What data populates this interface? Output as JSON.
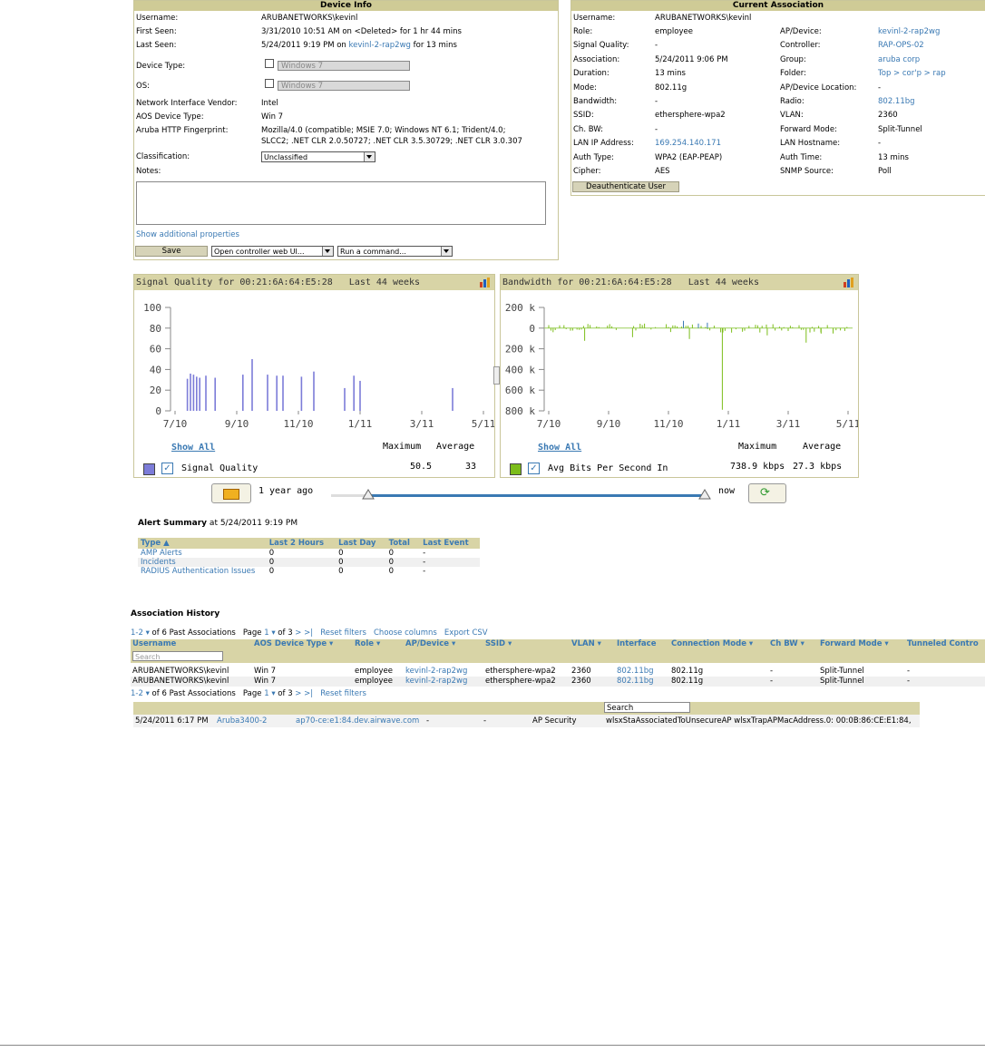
{
  "device_info": {
    "title": "Device Info",
    "rows": [
      {
        "label": "Username:",
        "value": "ARUBANETWORKS\\kevinl"
      },
      {
        "label": "First Seen:",
        "value": "3/31/2010 10:51 AM on <Deleted> for 1 hr 44 mins"
      },
      {
        "label": "Last Seen:",
        "value_pre": "5/24/2011 9:19 PM on ",
        "value_link": "kevinl-2-rap2wg",
        "value_post": " for 13 mins"
      }
    ],
    "device_type_label": "Device Type:",
    "device_type_value": "Windows 7",
    "os_label": "OS:",
    "os_value": "Windows 7",
    "vendor_label": "Network Interface Vendor:",
    "vendor_value": "Intel",
    "aos_type_label": "AOS Device Type:",
    "aos_type_value": "Win 7",
    "fingerprint_label": "Aruba HTTP Fingerprint:",
    "fingerprint_line1": "Mozilla/4.0 (compatible; MSIE 7.0; Windows NT 6.1; Trident/4.0;",
    "fingerprint_line2": "SLCC2; .NET CLR 2.0.50727; .NET CLR 3.5.30729; .NET CLR 3.0.307",
    "classification_label": "Classification:",
    "classification_value": "Unclassified",
    "notes_label": "Notes:",
    "show_props": "Show additional properties",
    "save_label": "Save",
    "controller_select": "Open controller web UI...",
    "command_select": "Run a command..."
  },
  "current_association": {
    "title": "Current Association",
    "username_label": "Username:",
    "username_value": "ARUBANETWORKS\\kevinl",
    "left": [
      {
        "label": "Role:",
        "value": "employee",
        "link": false
      },
      {
        "label": "Signal Quality:",
        "value": "-",
        "link": false
      },
      {
        "label": "Association:",
        "value": "5/24/2011 9:06 PM",
        "link": false
      },
      {
        "label": "Duration:",
        "value": "13 mins",
        "link": false
      },
      {
        "label": "Mode:",
        "value": "802.11g",
        "link": false
      },
      {
        "label": "Bandwidth:",
        "value": "-",
        "link": false
      },
      {
        "label": "SSID:",
        "value": "ethersphere-wpa2",
        "link": false
      },
      {
        "label": "Ch. BW:",
        "value": "-",
        "link": false
      },
      {
        "label": "LAN IP Address:",
        "value": "169.254.140.171",
        "link": true
      },
      {
        "label": "Auth Type:",
        "value": "WPA2 (EAP-PEAP)",
        "link": false
      },
      {
        "label": "Cipher:",
        "value": "AES",
        "link": false
      }
    ],
    "right": [
      {
        "label": "AP/Device:",
        "value": "kevinl-2-rap2wg",
        "link": true
      },
      {
        "label": "Controller:",
        "value": "RAP-OPS-02",
        "link": true
      },
      {
        "label": "Group:",
        "value": "aruba corp",
        "link": true
      },
      {
        "label": "Folder:",
        "value": "Top > cor'p > rap",
        "link": true
      },
      {
        "label": "AP/Device Location:",
        "value": "-",
        "link": false
      },
      {
        "label": "Radio:",
        "value": "802.11bg",
        "link": true
      },
      {
        "label": "VLAN:",
        "value": "2360",
        "link": false
      },
      {
        "label": "Forward Mode:",
        "value": "Split-Tunnel",
        "link": false
      },
      {
        "label": "LAN Hostname:",
        "value": "-",
        "link": false
      },
      {
        "label": "Auth Time:",
        "value": "13 mins",
        "link": false
      },
      {
        "label": "SNMP Source:",
        "value": "Poll",
        "link": false
      }
    ],
    "deauth_label": "Deauthenticate User"
  },
  "chart_data": [
    {
      "type": "bar",
      "title": "Signal Quality for 00:21:6A:64:E5:28   Last 44 weeks",
      "yticks": [
        "100",
        "80",
        "60",
        "40",
        "20",
        "0"
      ],
      "xticks": [
        "7/10",
        "9/10",
        "11/10",
        "1/11",
        "3/11",
        "5/11"
      ],
      "ylim": [
        0,
        100
      ],
      "series": [
        {
          "name": "Signal Quality",
          "color": "#7c7cd8",
          "points": [
            [
              0.04,
              31
            ],
            [
              0.05,
              36
            ],
            [
              0.06,
              35
            ],
            [
              0.07,
              33
            ],
            [
              0.08,
              32
            ],
            [
              0.1,
              34
            ],
            [
              0.13,
              32
            ],
            [
              0.22,
              35
            ],
            [
              0.25,
              50
            ],
            [
              0.3,
              35
            ],
            [
              0.33,
              34
            ],
            [
              0.35,
              34
            ],
            [
              0.41,
              33
            ],
            [
              0.45,
              38
            ],
            [
              0.55,
              22
            ],
            [
              0.58,
              34
            ],
            [
              0.6,
              29
            ],
            [
              0.9,
              22
            ]
          ]
        }
      ],
      "show_all": "Show All",
      "max_label": "Maximum",
      "avg_label": "Average",
      "legend_label": "Signal Quality",
      "max_value": "50.5",
      "avg_value": "33"
    },
    {
      "type": "bar",
      "title": "Bandwidth for 00:21:6A:64:E5:28   Last 44 weeks",
      "yticks": [
        "200 k",
        "0",
        "200 k",
        "400 k",
        "600 k",
        "800 k"
      ],
      "xticks": [
        "7/10",
        "9/10",
        "11/10",
        "1/11",
        "3/11",
        "5/11"
      ],
      "show_all": "Show All",
      "max_label": "Maximum",
      "avg_label": "Average",
      "legend_label": "Avg Bits Per Second In",
      "max_value": "738.9 kbps",
      "avg_value": "27.3 kbps"
    }
  ],
  "time_slider": {
    "start_label": "1 year ago",
    "end_label": "now"
  },
  "alert_summary": {
    "title": "Alert Summary",
    "at": " at 5/24/2011 9:19 PM",
    "headers": [
      "Type ▲",
      "Last 2 Hours",
      "Last Day",
      "Total",
      "Last Event"
    ],
    "rows": [
      [
        "AMP Alerts",
        "0",
        "0",
        "0",
        "-"
      ],
      [
        "Incidents",
        "0",
        "0",
        "0",
        "-"
      ],
      [
        "RADIUS Authentication Issues",
        "0",
        "0",
        "0",
        "-"
      ]
    ]
  },
  "association_history": {
    "title": "Association History",
    "pager_top": {
      "range": "1-2",
      "of": " of 6 Past Associations",
      "page": "Page ",
      "page_num": "1",
      "of_pages": " of 3",
      "nav": " > >|",
      "reset": "Reset filters",
      "choose": "Choose columns",
      "export": "Export CSV"
    },
    "headers": [
      "Username",
      "AOS Device Type ▾",
      "Role ▾",
      "AP/Device ▾",
      "SSID ▾",
      "VLAN ▾",
      "Interface",
      "Connection Mode ▾",
      "Ch BW ▾",
      "Forward Mode ▾",
      "Tunneled Contro"
    ],
    "search_placeholder": "Search",
    "rows": [
      [
        "ARUBANETWORKS\\kevinl",
        "Win 7",
        "employee",
        "kevinl-2-rap2wg",
        "ethersphere-wpa2",
        "2360",
        "802.11bg",
        "802.11g",
        "-",
        "Split-Tunnel",
        "-"
      ],
      [
        "ARUBANETWORKS\\kevinl",
        "Win 7",
        "employee",
        "kevinl-2-rap2wg",
        "ethersphere-wpa2",
        "2360",
        "802.11bg",
        "802.11g",
        "-",
        "Split-Tunnel",
        "-"
      ]
    ],
    "pager_bottom": {
      "range": "1-2",
      "of": " of 6 Past Associations",
      "page": "Page ",
      "page_num": "1",
      "of_pages": " of 3",
      "nav": " > >|",
      "reset": "Reset filters"
    }
  },
  "trap_table": {
    "search_label": "Search",
    "row": [
      "5/24/2011 6:17 PM",
      "Aruba3400-2",
      "ap70-ce:e1:84.dev.airwave.com",
      "-",
      "-",
      "AP Security",
      "wlsxStaAssociatedToUnsecureAP wlsxTrapAPMacAddress.0: 00:0B:86:CE:E1:84,"
    ]
  }
}
